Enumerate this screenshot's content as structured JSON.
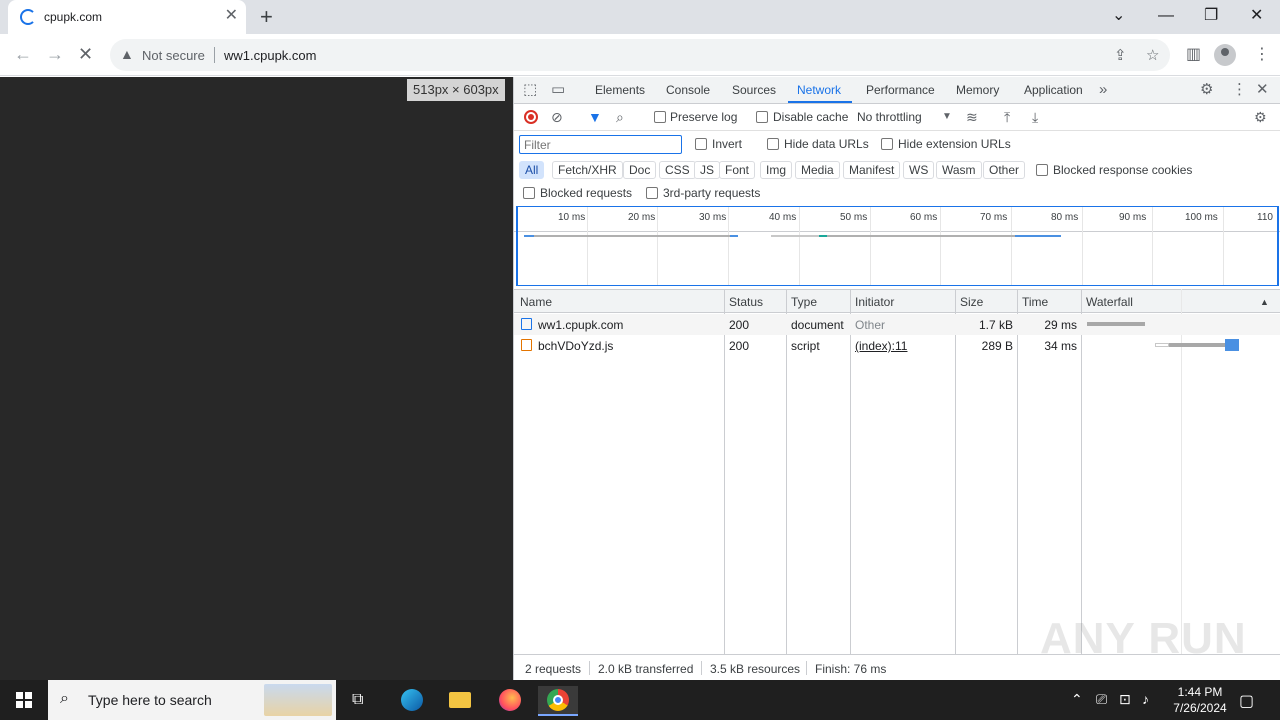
{
  "browser": {
    "tab_title": "cpupk.com",
    "tab_close": "✕",
    "new_tab": "+",
    "security_label": "Not secure",
    "url": "ww1.cpupk.com",
    "window_controls": [
      "minimize-icon",
      "restore-icon",
      "close-icon"
    ]
  },
  "viewport": {
    "size_badge": "513px × 603px"
  },
  "devtools": {
    "tabs": [
      "Elements",
      "Console",
      "Sources",
      "Network",
      "Performance",
      "Memory",
      "Application"
    ],
    "active_tab": "Network",
    "toolbar": {
      "preserve_log": "Preserve log",
      "disable_cache": "Disable cache",
      "throttling": "No throttling"
    },
    "filter_bar": {
      "placeholder": "Filter",
      "invert": "Invert",
      "hide_data_urls": "Hide data URLs",
      "hide_extension_urls": "Hide extension URLs"
    },
    "type_filters": [
      "All",
      "Fetch/XHR",
      "Doc",
      "CSS",
      "JS",
      "Font",
      "Img",
      "Media",
      "Manifest",
      "WS",
      "Wasm",
      "Other"
    ],
    "active_type_filter": "All",
    "blocked_response_cookies": "Blocked response cookies",
    "blocked_requests": "Blocked requests",
    "third_party_requests": "3rd-party requests",
    "overview_ticks": [
      "10 ms",
      "20 ms",
      "30 ms",
      "40 ms",
      "50 ms",
      "60 ms",
      "70 ms",
      "80 ms",
      "90 ms",
      "100 ms",
      "110"
    ],
    "columns": [
      "Name",
      "Status",
      "Type",
      "Initiator",
      "Size",
      "Time",
      "Waterfall"
    ],
    "requests": [
      {
        "name": "ww1.cpupk.com",
        "status": "200",
        "type": "document",
        "initiator": "Other",
        "size": "1.7 kB",
        "time": "29 ms"
      },
      {
        "name": "bchVDoYzd.js",
        "status": "200",
        "type": "script",
        "initiator": "(index):11",
        "size": "289 B",
        "time": "34 ms"
      }
    ],
    "status_bar": {
      "requests": "2 requests",
      "transferred": "2.0 kB transferred",
      "resources": "3.5 kB resources",
      "finish": "Finish: 76 ms"
    }
  },
  "watermark": "ANY RUN",
  "taskbar": {
    "search_placeholder": "Type here to search",
    "time": "1:44 PM",
    "date": "7/26/2024"
  },
  "colors": {
    "accent": "#1a73e8",
    "record_red": "#d93025",
    "page_bg": "#282828"
  }
}
